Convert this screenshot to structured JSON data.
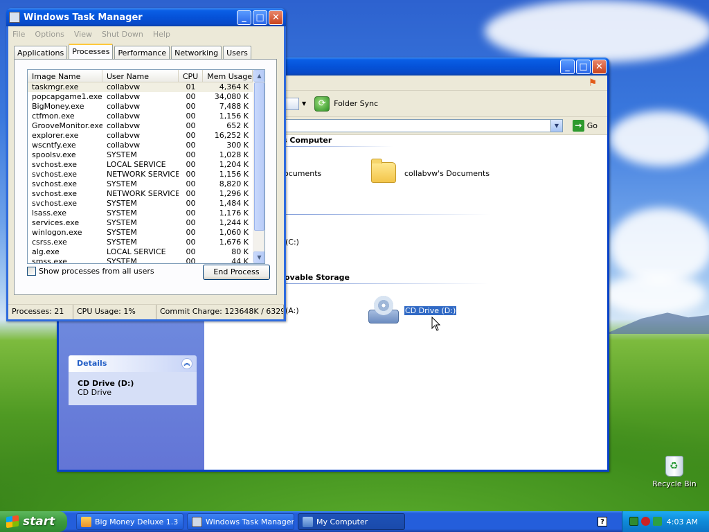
{
  "desktop": {
    "recycle_bin": "Recycle Bin"
  },
  "my_computer": {
    "title": "My Computer",
    "toolbar": {
      "folder_sync": "Folder Sync"
    },
    "address": {
      "go": "Go"
    },
    "groups": {
      "files": "s Computer",
      "removable": "ovable Storage"
    },
    "items": {
      "shared_docs_partial": "ocuments",
      "user_docs": "collabvw's Documents",
      "local_disk_partial": "(C:)",
      "floppy_partial": "(A:)",
      "cd_drive": "CD Drive (D:)"
    },
    "details": {
      "header": "Details",
      "name": "CD Drive (D:)",
      "type": "CD Drive"
    }
  },
  "task_manager": {
    "title": "Windows Task Manager",
    "menu": [
      "File",
      "Options",
      "View",
      "Shut Down",
      "Help"
    ],
    "tabs": [
      "Applications",
      "Processes",
      "Performance",
      "Networking",
      "Users"
    ],
    "active_tab": "Processes",
    "columns": [
      "Image Name",
      "User Name",
      "CPU",
      "Mem Usage"
    ],
    "processes": [
      {
        "name": "taskmgr.exe",
        "user": "collabvw",
        "cpu": "01",
        "mem": "4,364 K"
      },
      {
        "name": "popcapgame1.exe",
        "user": "collabvw",
        "cpu": "00",
        "mem": "34,080 K"
      },
      {
        "name": "BigMoney.exe",
        "user": "collabvw",
        "cpu": "00",
        "mem": "7,488 K"
      },
      {
        "name": "ctfmon.exe",
        "user": "collabvw",
        "cpu": "00",
        "mem": "1,156 K"
      },
      {
        "name": "GrooveMonitor.exe",
        "user": "collabvw",
        "cpu": "00",
        "mem": "652 K"
      },
      {
        "name": "explorer.exe",
        "user": "collabvw",
        "cpu": "00",
        "mem": "16,252 K"
      },
      {
        "name": "wscntfy.exe",
        "user": "collabvw",
        "cpu": "00",
        "mem": "300 K"
      },
      {
        "name": "spoolsv.exe",
        "user": "SYSTEM",
        "cpu": "00",
        "mem": "1,028 K"
      },
      {
        "name": "svchost.exe",
        "user": "LOCAL SERVICE",
        "cpu": "00",
        "mem": "1,204 K"
      },
      {
        "name": "svchost.exe",
        "user": "NETWORK SERVICE",
        "cpu": "00",
        "mem": "1,156 K"
      },
      {
        "name": "svchost.exe",
        "user": "SYSTEM",
        "cpu": "00",
        "mem": "8,820 K"
      },
      {
        "name": "svchost.exe",
        "user": "NETWORK SERVICE",
        "cpu": "00",
        "mem": "1,296 K"
      },
      {
        "name": "svchost.exe",
        "user": "SYSTEM",
        "cpu": "00",
        "mem": "1,484 K"
      },
      {
        "name": "lsass.exe",
        "user": "SYSTEM",
        "cpu": "00",
        "mem": "1,176 K"
      },
      {
        "name": "services.exe",
        "user": "SYSTEM",
        "cpu": "00",
        "mem": "1,244 K"
      },
      {
        "name": "winlogon.exe",
        "user": "SYSTEM",
        "cpu": "00",
        "mem": "1,060 K"
      },
      {
        "name": "csrss.exe",
        "user": "SYSTEM",
        "cpu": "00",
        "mem": "1,676 K"
      },
      {
        "name": "alg.exe",
        "user": "LOCAL SERVICE",
        "cpu": "00",
        "mem": "80 K"
      },
      {
        "name": "smss.exe",
        "user": "SYSTEM",
        "cpu": "00",
        "mem": "44 K"
      }
    ],
    "show_all_label": "Show processes from all users",
    "end_process": "End Process",
    "status": {
      "processes": "Processes: 21",
      "cpu": "CPU Usage: 1%",
      "commit": "Commit Charge: 123648K / 6329"
    }
  },
  "taskbar": {
    "start": "start",
    "tasks": [
      "Big Money Deluxe 1.3",
      "Windows Task Manager",
      "My Computer"
    ],
    "help_icon": "?",
    "clock": "4:03 AM"
  }
}
